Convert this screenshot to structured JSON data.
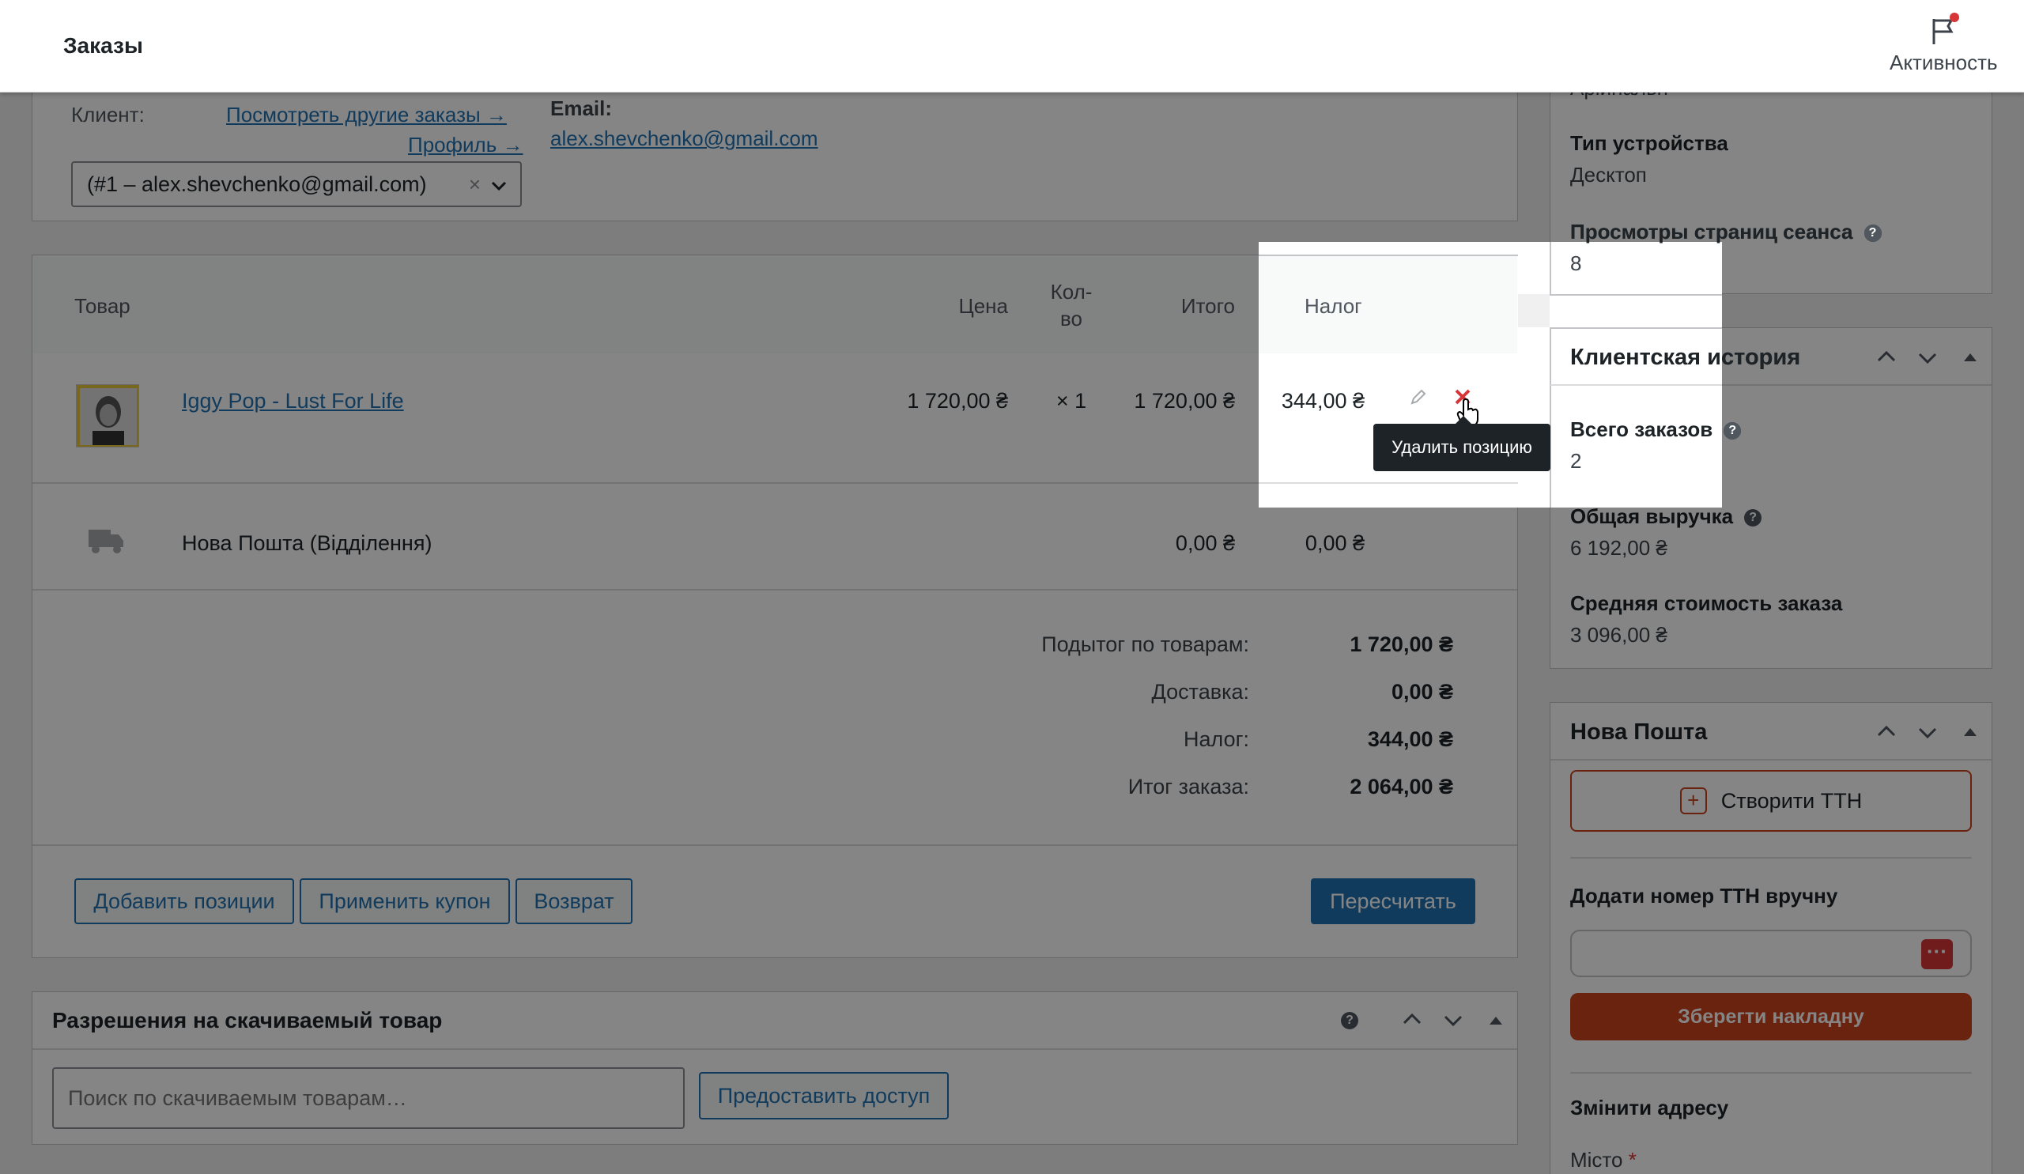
{
  "header": {
    "title": "Заказы",
    "activity_label": "Активность"
  },
  "customer": {
    "label": "Клиент:",
    "other_orders_link": "Посмотреть другие заказы →",
    "profile_link": "Профиль →",
    "select_value": "(#1 – alex.shevchenko@gmail.com)",
    "email_label": "Email:",
    "email_value": "alex.shevchenko@gmail.com"
  },
  "items_table": {
    "headers": {
      "product": "Товар",
      "price": "Цена",
      "qty": "Кол-во",
      "total": "Итого",
      "tax": "Налог"
    },
    "product": {
      "name": "Iggy Pop - Lust For Life",
      "price": "1 720,00 ₴",
      "qty": "× 1",
      "total": "1 720,00 ₴",
      "tax": "344,00 ₴"
    },
    "shipping": {
      "name": "Нова Пошта (Відділення)",
      "total": "0,00 ₴",
      "tax": "0,00 ₴"
    },
    "tooltip": "Удалить позицию"
  },
  "totals": [
    {
      "label": "Подытог по товарам:",
      "value": "1 720,00 ₴"
    },
    {
      "label": "Доставка:",
      "value": "0,00 ₴"
    },
    {
      "label": "Налог:",
      "value": "344,00 ₴"
    },
    {
      "label": "Итог заказа:",
      "value": "2 064,00 ₴"
    }
  ],
  "actions": {
    "add_items": "Добавить позиции",
    "apply_coupon": "Применить купон",
    "refund": "Возврат",
    "recalculate": "Пересчитать"
  },
  "downloads": {
    "title": "Разрешения на скачиваемый товар",
    "search_placeholder": "Поиск по скачиваемым товарам…",
    "grant_button": "Предоставить доступ"
  },
  "sidebar": {
    "partial_top": "Аріинальн",
    "device_label": "Тип устройства",
    "device_value": "Десктоп",
    "pageviews_label": "Просмотры страниц сеанса",
    "pageviews_value": "8",
    "history": {
      "title": "Клиентская история",
      "total_orders_label": "Всего заказов",
      "total_orders_value": "2",
      "revenue_label": "Общая выручка",
      "revenue_value": "6 192,00 ₴",
      "avg_label": "Средняя стоимость заказа",
      "avg_value": "3 096,00 ₴"
    },
    "nova": {
      "title": "Нова Пошта",
      "create_ttn": "Створити ТТН",
      "manual_label": "Додати номер ТТН вручну",
      "save_button": "Зберегти накладну",
      "address_title": "Змінити адресу",
      "city_label": "Місто",
      "required": "*"
    }
  },
  "colors": {
    "accent": "#2271b1",
    "danger": "#d63638",
    "nova_orange": "#c9431b"
  }
}
